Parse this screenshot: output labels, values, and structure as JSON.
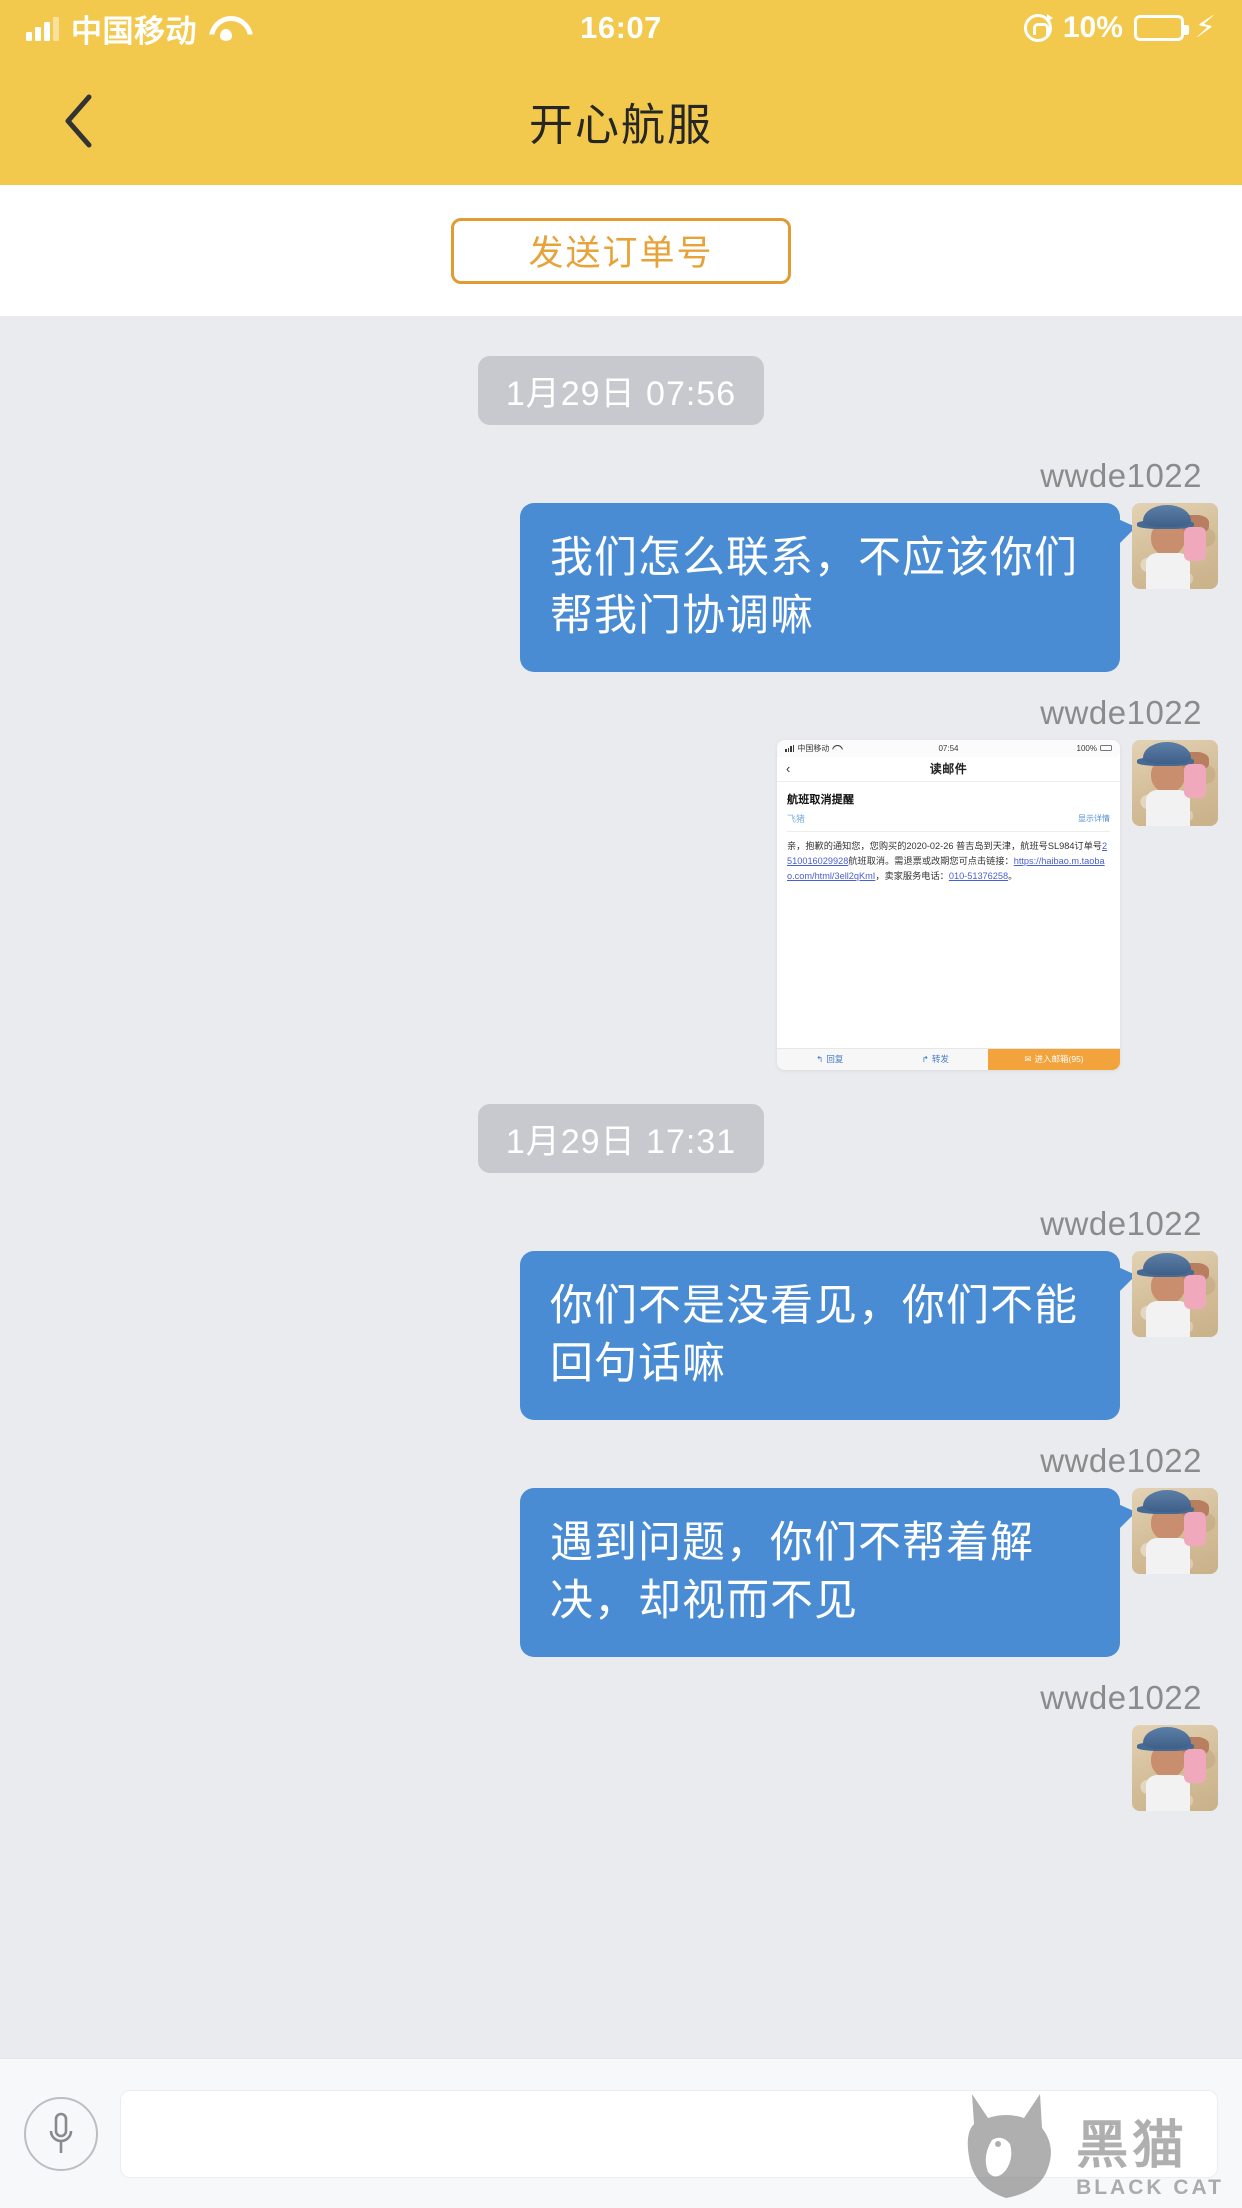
{
  "status_bar": {
    "carrier": "中国移动",
    "time": "16:07",
    "battery_percent": "10%",
    "signal_icon": "signal-bars-icon",
    "wifi_icon": "wifi-icon",
    "rotation_lock_icon": "rotation-lock-icon",
    "battery_icon": "battery-icon",
    "charging_icon": "lightning-bolt-icon"
  },
  "nav": {
    "back_icon": "back-chevron-icon",
    "title": "开心航服"
  },
  "toolbar": {
    "send_order_label": "发送订单号"
  },
  "chat": {
    "sender_name": "wwde1022",
    "avatar_name": "user-avatar-baby-beach",
    "groups": [
      {
        "timestamp": "1月29日 07:56",
        "messages": [
          {
            "type": "text",
            "sender": "wwde1022",
            "text": "我们怎么联系，不应该你们帮我门协调嘛"
          },
          {
            "type": "image",
            "sender": "wwde1022",
            "alt": "email-screenshot-flight-cancellation"
          }
        ]
      },
      {
        "timestamp": "1月29日 17:31",
        "messages": [
          {
            "type": "text",
            "sender": "wwde1022",
            "text": "你们不是没看见，你们不能回句话嘛"
          },
          {
            "type": "text",
            "sender": "wwde1022",
            "text": "遇到问题，你们不帮着解决，却视而不见"
          },
          {
            "type": "partial",
            "sender": "wwde1022"
          }
        ]
      }
    ]
  },
  "email_screenshot": {
    "status_carrier": "中国移动",
    "status_time": "07:54",
    "status_battery": "100%",
    "nav_back_icon": "back-chevron-icon",
    "nav_title": "读邮件",
    "subject": "航班取消提醒",
    "from": "飞猪",
    "show_detail": "显示详情",
    "body_part1": "亲，抱歉的通知您，您购买的2020-02-26 普吉岛到天津，航班号SL984订单号",
    "body_link1": "2510016029928",
    "body_part2": "航班取消。需退票或改期您可点击链接：",
    "body_link2": "https://haibao.m.taobao.com/html/3ell2qKmI",
    "body_part3": "，卖家服务电话：",
    "body_link3": "010-51376258",
    "body_part4": "。",
    "action_reply": "回复",
    "action_forward": "转发",
    "action_inbox": "进入邮箱(95)",
    "reply_icon": "reply-arrow-icon",
    "forward_icon": "forward-arrow-icon",
    "inbox_icon": "mail-inbox-icon"
  },
  "input_bar": {
    "mic_icon": "microphone-icon",
    "input_value": "",
    "input_placeholder": ""
  },
  "watermark": {
    "cat_icon": "black-cat-logo-icon",
    "chinese": "黑猫",
    "english": "BLACK CAT"
  },
  "colors": {
    "header_yellow": "#F2C94C",
    "bubble_blue": "#4A8CD4",
    "accent_orange": "#E09B32",
    "chat_bg": "#EAEBEE",
    "timechip_gray": "#C8C9CE"
  }
}
